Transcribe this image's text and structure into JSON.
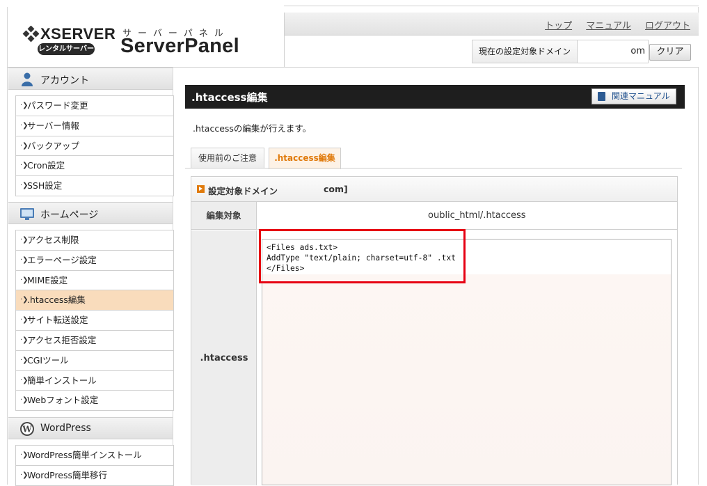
{
  "header": {
    "logo_brand": "XSERVER",
    "logo_rental": "レンタルサーバー",
    "logo_kana": "サーバーパネル",
    "logo_product": "ServerPanel",
    "links": [
      "トップ",
      "マニュアル",
      "ログアウト"
    ],
    "domain_label": "現在の設定対象ドメイン",
    "domain_value": "om",
    "clear_button": "クリア"
  },
  "sidebar": {
    "sections": [
      {
        "title": "アカウント",
        "icon": "user-icon",
        "items": [
          "パスワード変更",
          "サーバー情報",
          "バックアップ",
          "Cron設定",
          "SSH設定"
        ]
      },
      {
        "title": "ホームページ",
        "icon": "monitor-icon",
        "items": [
          "アクセス制限",
          "エラーページ設定",
          "MIME設定",
          ".htaccess編集",
          "サイト転送設定",
          "アクセス拒否設定",
          "CGIツール",
          "簡単インストール",
          "Webフォント設定"
        ],
        "active_item": ".htaccess編集"
      },
      {
        "title": "WordPress",
        "icon": "wordpress-icon",
        "items": [
          "WordPress簡単インストール",
          "WordPress簡単移行"
        ]
      }
    ]
  },
  "main": {
    "title": ".htaccess編集",
    "manual_button": "関連マニュアル",
    "description": ".htaccessの編集が行えます。",
    "tabs": [
      {
        "label": "使用前のご注意",
        "active": false
      },
      {
        "label": ".htaccess編集",
        "active": true
      }
    ],
    "form": {
      "target_domain_label": "設定対象ドメイン",
      "target_domain_value": "com]",
      "edit_target_label": "編集対象",
      "edit_target_value": "oublic_html/.htaccess",
      "htaccess_label": ".htaccess",
      "editor_lines": [
        "<Files ads.txt>",
        "AddType \"text/plain; charset=utf-8\" .txt",
        "</Files>"
      ]
    }
  },
  "colors": {
    "accent_orange": "#e07a0b",
    "active_item_bg": "#f9dcbc",
    "title_bar": "#1e1e1e",
    "highlight_red": "#e60012"
  }
}
